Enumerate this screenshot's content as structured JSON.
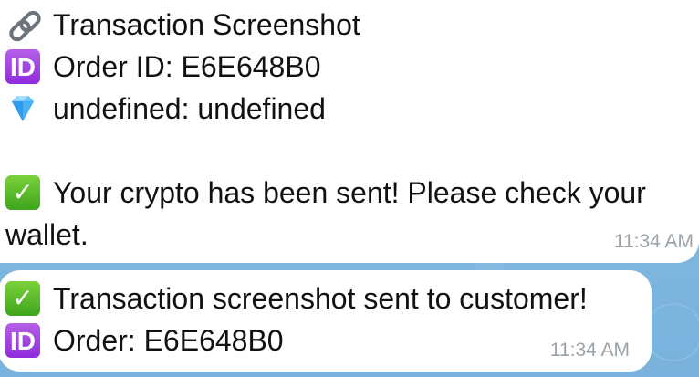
{
  "messages": [
    {
      "lines": [
        {
          "icon": "link-icon",
          "text": "Transaction Screenshot"
        },
        {
          "icon": "id-badge-icon",
          "text": "Order ID: E6E648B0"
        },
        {
          "icon": "gem-icon",
          "text": "undefined: undefined"
        }
      ],
      "body_line_1": "Your crypto has been sent! Please check your",
      "body_line_2": "wallet.",
      "body_icon": "check-icon",
      "time": "11:34 AM"
    },
    {
      "lines": [
        {
          "icon": "check-icon",
          "text": "Transaction screenshot sent to customer!"
        },
        {
          "icon": "id-badge-icon",
          "text": "Order: E6E648B0"
        }
      ],
      "time": "11:34 AM"
    }
  ],
  "icons": {
    "id_text": "ID",
    "check_text": "✓"
  },
  "colors": {
    "background": "#7fb7e0",
    "bubble": "#ffffff",
    "timestamp": "#9aa1a7",
    "id_badge": "#9a38df",
    "check_badge": "#47ad22"
  }
}
